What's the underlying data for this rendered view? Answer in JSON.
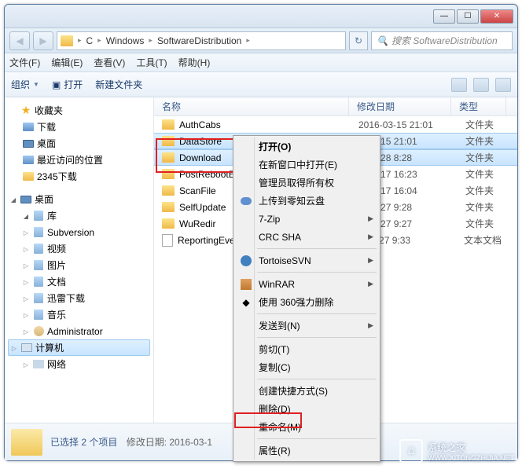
{
  "breadcrumb": {
    "drive": "C",
    "p1": "Windows",
    "p2": "SoftwareDistribution"
  },
  "search": {
    "placeholder": "搜索 SoftwareDistribution"
  },
  "menubar": {
    "file": "文件(F)",
    "edit": "编辑(E)",
    "view": "查看(V)",
    "tools": "工具(T)",
    "help": "帮助(H)"
  },
  "toolbar": {
    "organize": "组织",
    "open": "打开",
    "newfolder": "新建文件夹"
  },
  "sidebar": {
    "favorites": "收藏夹",
    "downloads": "下载",
    "desktop": "桌面",
    "recent": "最近访问的位置",
    "dl2345": "2345下载",
    "desktop2": "桌面",
    "libraries": "库",
    "subversion": "Subversion",
    "videos": "视频",
    "pictures": "图片",
    "documents": "文档",
    "xunlei": "迅雷下载",
    "music": "音乐",
    "admin": "Administrator",
    "computer": "计算机",
    "network": "网络"
  },
  "columns": {
    "name": "名称",
    "date": "修改日期",
    "type": "类型"
  },
  "files": [
    {
      "name": "AuthCabs",
      "date": "2016-03-15 21:01",
      "type": "文件夹",
      "selected": false,
      "kind": "folder"
    },
    {
      "name": "DataStore",
      "date": "5-03-15 21:01",
      "type": "文件夹",
      "selected": true,
      "kind": "folder"
    },
    {
      "name": "Download",
      "date": "7-02-28 8:28",
      "type": "文件夹",
      "selected": true,
      "kind": "folder"
    },
    {
      "name": "PostRebootE",
      "date": "7-02-17 16:23",
      "type": "文件夹",
      "selected": false,
      "kind": "folder"
    },
    {
      "name": "ScanFile",
      "date": "7-02-17 16:04",
      "type": "文件夹",
      "selected": false,
      "kind": "folder"
    },
    {
      "name": "SelfUpdate",
      "date": "7-02-27 9:28",
      "type": "文件夹",
      "selected": false,
      "kind": "folder"
    },
    {
      "name": "WuRedir",
      "date": "7-02-27 9:27",
      "type": "文件夹",
      "selected": false,
      "kind": "folder"
    },
    {
      "name": "ReportingEve",
      "date": "7-02-27 9:33",
      "type": "文本文档",
      "selected": false,
      "kind": "txt"
    }
  ],
  "context_menu": {
    "open": "打开(O)",
    "open_new": "在新窗口中打开(E)",
    "ownership": "管理员取得所有权",
    "upload_cloud": "上传到零知云盘",
    "sevenzip": "7-Zip",
    "crcsha": "CRC SHA",
    "tortoise": "TortoiseSVN",
    "winrar": "WinRAR",
    "force_delete": "使用 360强力删除",
    "sendto": "发送到(N)",
    "cut": "剪切(T)",
    "copy": "复制(C)",
    "shortcut": "创建快捷方式(S)",
    "delete": "删除(D)",
    "rename": "重命名(M)",
    "properties": "属性(R)"
  },
  "statusbar": {
    "selection": "已选择 2 个项目",
    "modified_label": "修改日期:",
    "modified_value": "2016-03-1"
  },
  "watermark": {
    "text": "系统之家",
    "url": "WWW.XITONGZHIJIA.NET"
  }
}
